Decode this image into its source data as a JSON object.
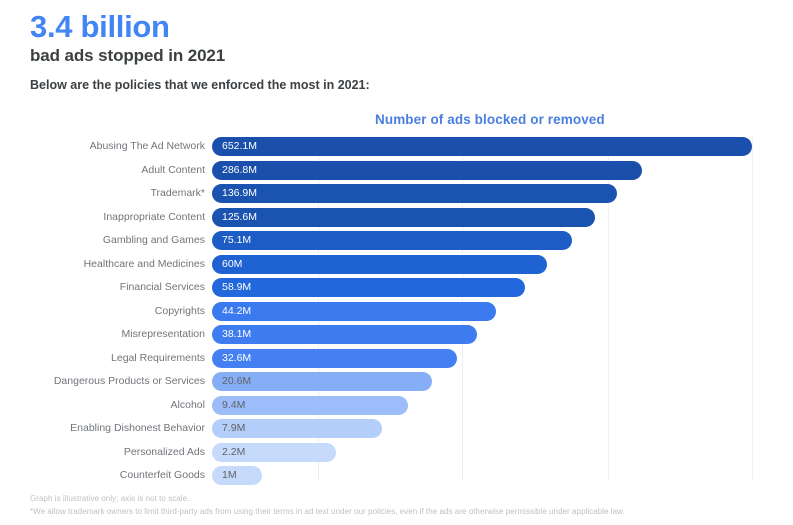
{
  "header": {
    "headline": "3.4 billion",
    "subhead": "bad ads stopped in 2021",
    "lede": "Below are the policies that we enforced the most in 2021:",
    "headline_color": "#4285f4"
  },
  "footnotes": {
    "line1": "Graph is illustrative only; axis is not to scale.",
    "line2": "*We allow trademark owners to limit third-party ads from using their terms in ad text under our policies, even if the ads are otherwise permissible under applicable law."
  },
  "chart_data": {
    "type": "bar",
    "orientation": "horizontal",
    "title": "Number of ads blocked or removed",
    "xlabel": "",
    "ylabel": "",
    "grid": true,
    "gridlines_x": [
      318,
      462,
      608,
      752
    ],
    "axis_to_scale": false,
    "legend": "none",
    "categories": [
      "Abusing The Ad Network",
      "Adult Content",
      "Trademark*",
      "Inappropriate Content",
      "Gambling and Games",
      "Healthcare and Medicines",
      "Financial Services",
      "Copyrights",
      "Misrepresentation",
      "Legal Requirements",
      "Dangerous Products or Services",
      "Alcohol",
      "Enabling Dishonest Behavior",
      "Personalized Ads",
      "Counterfeit Goods"
    ],
    "values": [
      652.1,
      286.8,
      136.9,
      125.6,
      75.1,
      60,
      58.9,
      44.2,
      38.1,
      32.6,
      20.6,
      9.4,
      7.9,
      2.2,
      1
    ],
    "value_labels": [
      "652.1M",
      "286.8M",
      "136.9M",
      "125.6M",
      "75.1M",
      "60M",
      "58.9M",
      "44.2M",
      "38.1M",
      "32.6M",
      "20.6M",
      "9.4M",
      "7.9M",
      "2.2M",
      "1M"
    ],
    "value_unit": "M",
    "bar_pixel_widths": [
      540,
      430,
      405,
      383,
      360,
      335,
      313,
      284,
      265,
      245,
      220,
      196,
      170,
      124,
      50
    ],
    "bar_colors": [
      "#1a50ab",
      "#1a50ab",
      "#1a53b0",
      "#1a53b0",
      "#1c5cc4",
      "#1f62d2",
      "#2267dc",
      "#3b79ee",
      "#3f7cf0",
      "#4480f2",
      "#86aef7",
      "#9cbdf9",
      "#b4cefa",
      "#c6dafb",
      "#c6dafb"
    ],
    "value_text_colors": [
      "#ffffff",
      "#ffffff",
      "#ffffff",
      "#ffffff",
      "#ffffff",
      "#ffffff",
      "#ffffff",
      "#ffffff",
      "#ffffff",
      "#ffffff",
      "#5f6368",
      "#5f6368",
      "#5f6368",
      "#5f6368",
      "#5f6368"
    ]
  }
}
